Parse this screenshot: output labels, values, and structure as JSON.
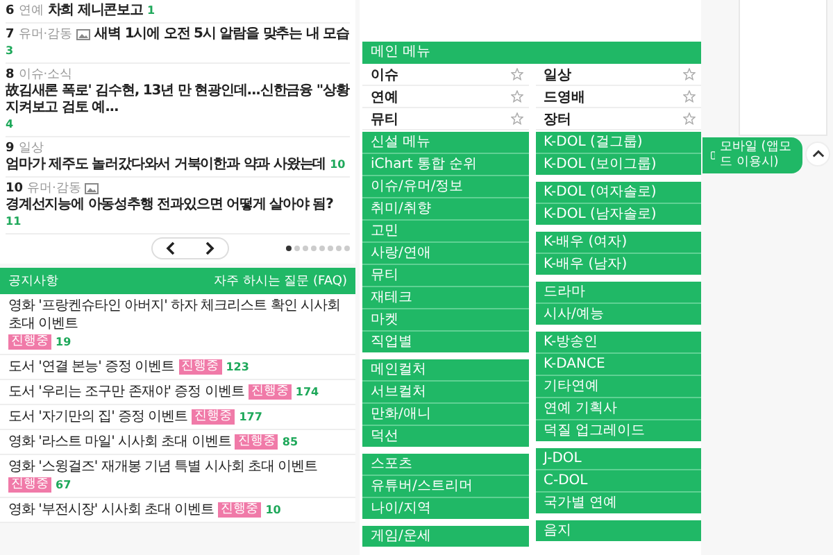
{
  "ranking": [
    {
      "rank": "6",
      "category": "연예",
      "has_image": false,
      "title": "차희 제니콘보고",
      "comments": "1"
    },
    {
      "rank": "7",
      "category": "유머·감동",
      "has_image": true,
      "title": "새벽 1시에 오전 5시 알람을 맞추는 내 모습",
      "comments": "3"
    },
    {
      "rank": "8",
      "category": "이슈·소식",
      "has_image": false,
      "title": "故김새론 폭로' 김수현, 13년 만 현광인데...신한금융 \"상황 지켜보고 검토 예...",
      "comments": "4"
    },
    {
      "rank": "9",
      "category": "일상",
      "has_image": false,
      "title": "엄마가 제주도 놀러갔다와서 거북이한과 약과 사왔는데",
      "comments": "10"
    },
    {
      "rank": "10",
      "category": "유머·감동",
      "has_image": true,
      "title": "경계선지능에 아동성추행 전과있으면 어떻게 살아야 됨?",
      "comments": "11"
    }
  ],
  "pager": {
    "dots": [
      {
        "selected": true
      },
      {
        "selected": false
      },
      {
        "selected": false
      },
      {
        "selected": false
      },
      {
        "selected": false
      },
      {
        "selected": false
      },
      {
        "selected": false
      },
      {
        "selected": false
      }
    ]
  },
  "notice": {
    "title": "공지사항",
    "faq": "자주 하시는 질문 (FAQ)",
    "items": [
      {
        "title": "영화 '프랑켄슈타인 아버지' 하자 체크리스트 확인 시사회 초대 이벤트",
        "badge": "진행중",
        "count": "19"
      },
      {
        "title": "도서 '연결 본능' 증정 이벤트",
        "badge": "진행중",
        "count": "123"
      },
      {
        "title": "도서 '우리는 조구만 존재야' 증정 이벤트",
        "badge": "진행중",
        "count": "174"
      },
      {
        "title": "도서 '자기만의 집' 증정 이벤트",
        "badge": "진행중",
        "count": "177"
      },
      {
        "title": "영화 '라스트 마일' 시사회 초대 이벤트",
        "badge": "진행중",
        "count": "85"
      },
      {
        "title": "영화 '스윙걸즈' 재개봉 기념 특별 시사회 초대 이벤트",
        "badge": "진행중",
        "count": "67"
      },
      {
        "title": "영화 '부전시장' 시사회 초대 이벤트",
        "badge": "진행중",
        "count": "10"
      }
    ]
  },
  "main_menu": {
    "title": "메인 메뉴",
    "favorites": [
      {
        "label": "이슈"
      },
      {
        "label": "일상"
      },
      {
        "label": "연예"
      },
      {
        "label": "드영배"
      },
      {
        "label": "뮤티"
      },
      {
        "label": "장터"
      }
    ]
  },
  "left_groups": [
    {
      "items": [
        "신설 메뉴",
        "iChart 통합 순위",
        "이슈/유머/정보",
        "취미/취향",
        "고민",
        "사랑/연애",
        "뮤티",
        "재테크",
        "마켓",
        "직업별"
      ]
    },
    {
      "items": [
        "메인컬처",
        "서브컬처",
        "만화/애니",
        "덕선"
      ]
    },
    {
      "items": [
        "스포츠",
        "유튜버/스트리머",
        "나이/지역"
      ]
    },
    {
      "items": [
        "게임/운세"
      ]
    }
  ],
  "right_groups": [
    {
      "items": [
        "K-DOL (걸그룹)",
        "K-DOL (보이그룹)"
      ]
    },
    {
      "items": [
        "K-DOL (여자솔로)",
        "K-DOL (남자솔로)"
      ]
    },
    {
      "items": [
        "K-배우 (여자)",
        "K-배우 (남자)"
      ]
    },
    {
      "items": [
        "드라마",
        "시사/예능"
      ]
    },
    {
      "items": [
        "K-방송인",
        "K-DANCE",
        "기타연예",
        "연예 기획사",
        "덕질 업그레이드"
      ]
    },
    {
      "items": [
        "J-DOL",
        "C-DOL",
        "국가별 연예"
      ]
    },
    {
      "items": [
        "음지"
      ]
    }
  ],
  "mobile_button": "모바일 (앱모드 이용시)"
}
